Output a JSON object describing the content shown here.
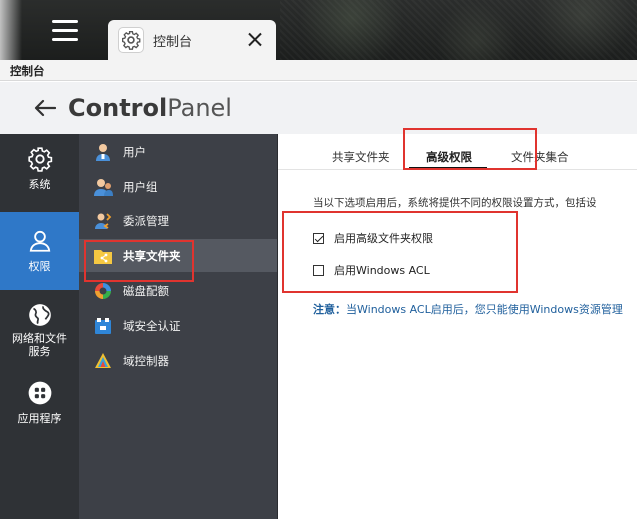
{
  "window": {
    "tab_title": "控制台",
    "title_strip": "控制台"
  },
  "header": {
    "brand_bold": "Control",
    "brand_light": "Panel"
  },
  "nav_primary": [
    {
      "id": "system",
      "label": "系统",
      "icon": "gear-icon",
      "active": false
    },
    {
      "id": "privilege",
      "label": "权限",
      "icon": "user-icon",
      "active": true
    },
    {
      "id": "network",
      "label_line1": "网络和文件",
      "label_line2": "服务",
      "icon": "globe-icon",
      "active": false
    },
    {
      "id": "apps",
      "label": "应用程序",
      "icon": "apps-grid-icon",
      "active": false
    }
  ],
  "nav_secondary": [
    {
      "id": "users",
      "label": "用户",
      "icon": "user-icon"
    },
    {
      "id": "user-groups",
      "label": "用户组",
      "icon": "user-group-icon"
    },
    {
      "id": "delegated-admin",
      "label": "委派管理",
      "icon": "delegate-icon"
    },
    {
      "id": "shared-folders",
      "label": "共享文件夹",
      "icon": "shared-folder-icon",
      "active": true
    },
    {
      "id": "quota",
      "label": "磁盘配额",
      "icon": "quota-icon"
    },
    {
      "id": "domain-security",
      "label": "域安全认证",
      "icon": "domain-security-icon"
    },
    {
      "id": "domain-controller",
      "label": "域控制器",
      "icon": "domain-controller-icon"
    }
  ],
  "tabs": [
    {
      "label": "共享文件夹",
      "active": false
    },
    {
      "label": "高级权限",
      "active": true
    },
    {
      "label": "文件夹集合",
      "active": false
    }
  ],
  "content": {
    "description": "当以下选项启用后，系统将提供不同的权限设置方式，包括设",
    "options": [
      {
        "label": "启用高级文件夹权限",
        "checked": true
      },
      {
        "label": "启用Windows ACL",
        "checked": false
      }
    ],
    "note_prefix": "注意：",
    "note_text": "当Windows ACL启用后，您只能使用Windows资源管理"
  },
  "colors": {
    "accent_blue": "#2f78c8",
    "highlight_red": "#e0342f",
    "note_blue": "#1f5f9c"
  }
}
